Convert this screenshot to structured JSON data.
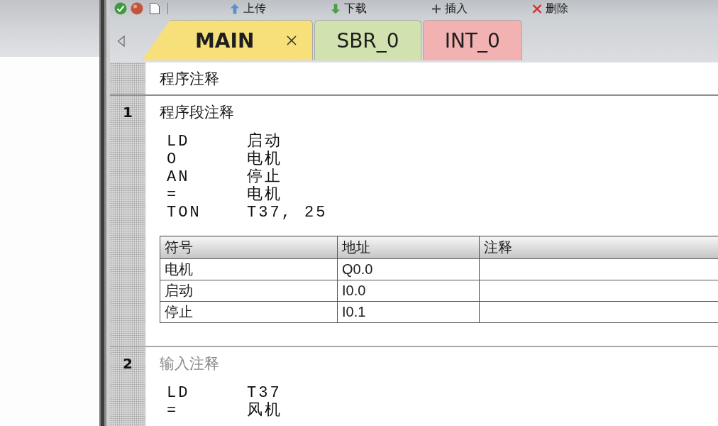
{
  "toolbar": {
    "buttons": [
      {
        "label": "上传",
        "kind": "upload"
      },
      {
        "label": "下载",
        "kind": "download"
      },
      {
        "label": "插入",
        "kind": "insert"
      },
      {
        "label": "删除",
        "kind": "delete"
      }
    ]
  },
  "tabs": [
    {
      "label": "MAIN",
      "selected": true,
      "color": "#f7e07a"
    },
    {
      "label": "SBR_0",
      "selected": false,
      "color": "#d2e2ae"
    },
    {
      "label": "INT_0",
      "selected": false,
      "color": "#f3b2b2"
    }
  ],
  "editor": {
    "program_comment": "程序注释",
    "networks": [
      {
        "number": "1",
        "comment": "程序段注释",
        "lines": [
          {
            "instruction": "LD",
            "operand": "启动"
          },
          {
            "instruction": "O",
            "operand": "电机"
          },
          {
            "instruction": "AN",
            "operand": "停止"
          },
          {
            "instruction": "=",
            "operand": "电机"
          },
          {
            "instruction": "TON",
            "operand": "T37, 25"
          }
        ],
        "symbol_table": {
          "columns": [
            "符号",
            "地址",
            "注释"
          ],
          "rows": [
            {
              "symbol": "电机",
              "address": "Q0.0"
            },
            {
              "symbol": "启动",
              "address": "I0.0"
            },
            {
              "symbol": "停止",
              "address": "I0.1"
            }
          ]
        }
      },
      {
        "number": "2",
        "placeholder": "输入注释",
        "lines": [
          {
            "instruction": "LD",
            "operand": "T37"
          },
          {
            "instruction": "=",
            "operand": "风机"
          }
        ]
      }
    ]
  }
}
